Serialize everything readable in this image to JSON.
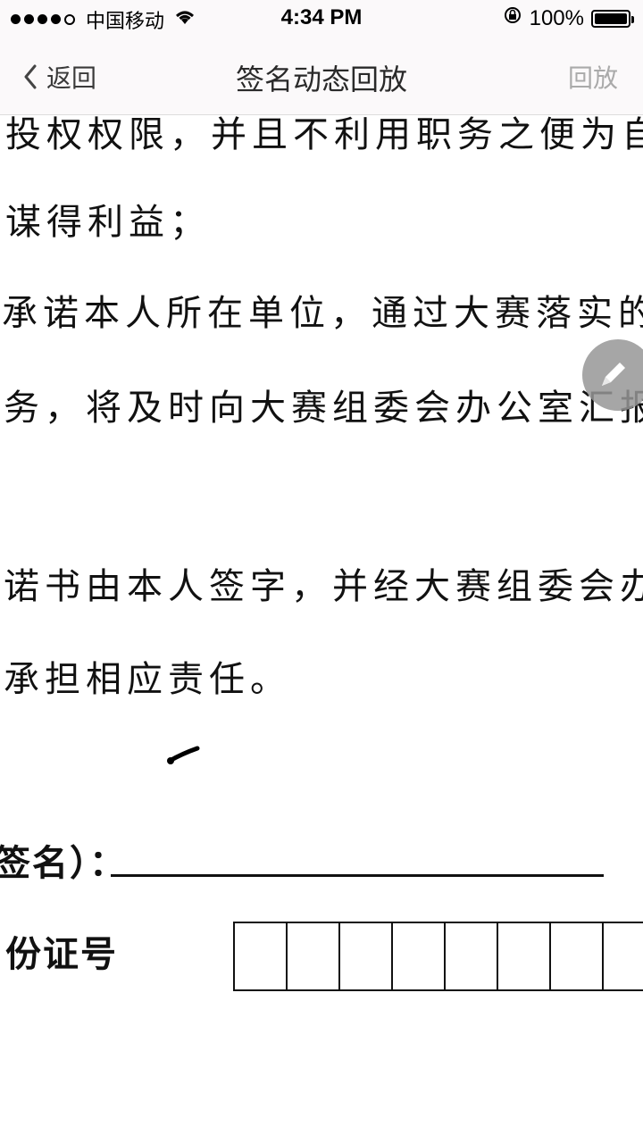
{
  "status_bar": {
    "carrier": "中国移动",
    "time": "4:34 PM",
    "battery": "100%"
  },
  "nav": {
    "back_label": "返回",
    "title": "签名动态回放",
    "replay_label": "回放"
  },
  "document": {
    "lines": [
      "投权权限，并且不利用职务之便为自",
      "谋得利益；",
      "承诺本人所在单位，通过大赛落实的",
      "务，将及时向大赛组委会办公室汇报",
      "诺书由本人签字，并经大赛组委会办",
      "承担相应责任。"
    ],
    "signature_label": "签名）：",
    "id_label": "份证号"
  }
}
